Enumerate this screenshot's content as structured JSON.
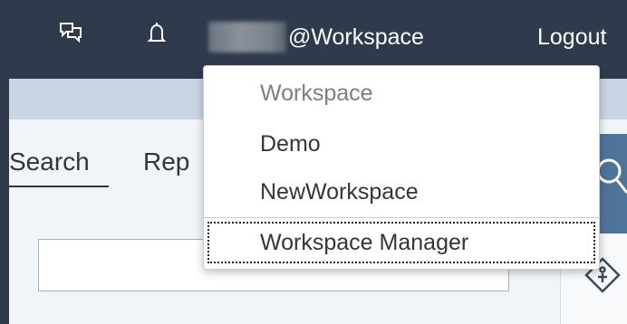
{
  "header": {
    "user_suffix": "@Workspace",
    "logout_label": "Logout"
  },
  "tabs": [
    {
      "label": "Search"
    },
    {
      "label": "Rep"
    }
  ],
  "workspace_menu": {
    "header": "Workspace",
    "items": [
      {
        "label": "Demo"
      },
      {
        "label": "NewWorkspace"
      }
    ],
    "manager_label": "Workspace Manager"
  },
  "search": {
    "value": "",
    "placeholder": ""
  },
  "icons": {
    "chat": "chat-icon",
    "bell": "bell-icon",
    "search": "search-icon",
    "tool": "tool-icon"
  },
  "colors": {
    "header_bg": "#2f3b4c",
    "accent_blue": "#4f7499",
    "panel_bg": "#f1f4f8"
  }
}
